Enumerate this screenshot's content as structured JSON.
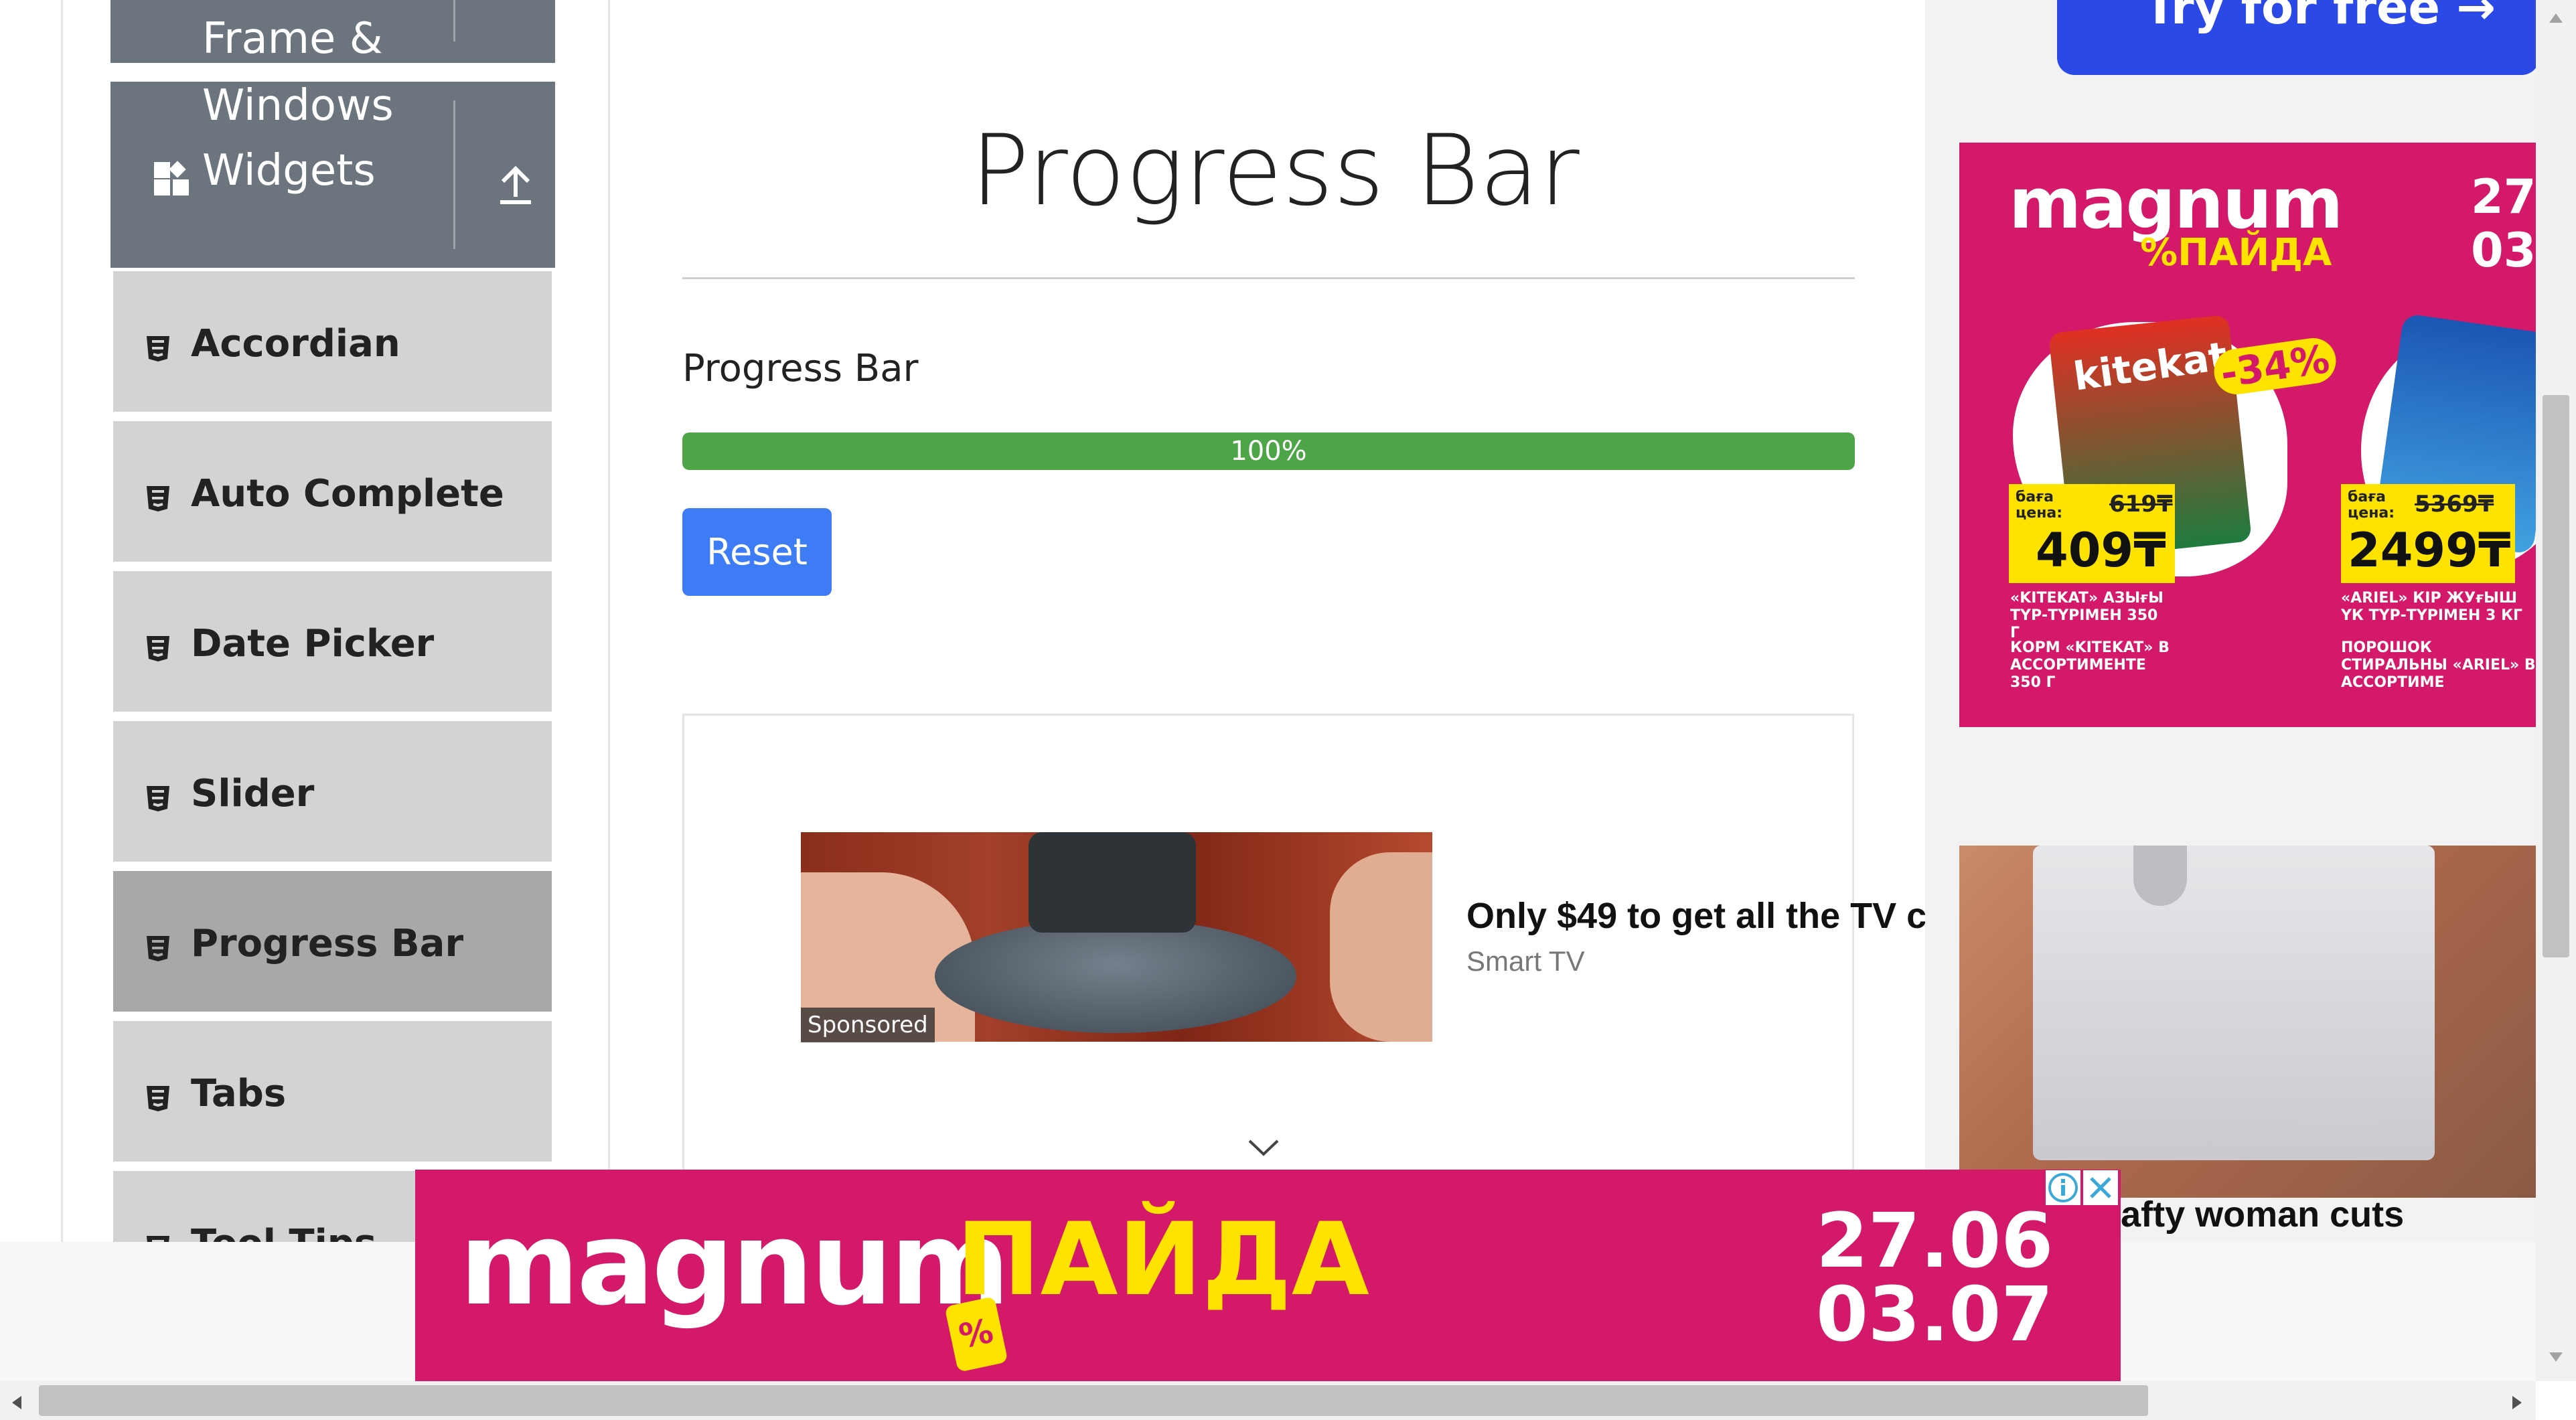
{
  "sidebar": {
    "category_frames": "Frame &\nWindows",
    "category_widgets": "Widgets",
    "items": [
      {
        "label": "Accordian"
      },
      {
        "label": "Auto Complete"
      },
      {
        "label": "Date Picker"
      },
      {
        "label": "Slider"
      },
      {
        "label": "Progress Bar"
      },
      {
        "label": "Tabs"
      },
      {
        "label": "Tool Tips"
      }
    ],
    "active_item": "Progress Bar"
  },
  "main": {
    "title": "Progress Bar",
    "section_label": "Progress Bar",
    "progress": {
      "value": 100,
      "text": "100%"
    },
    "reset_label": "Reset"
  },
  "ad_sponsored": {
    "sponsored_label": "Sponsored",
    "headline": "Only $49 to get all the TV c",
    "source": "Smart TV"
  },
  "right_ads": {
    "try_label": "Try for free →",
    "magnum_logo": "magnum",
    "magnum_sub": "%ПАЙДА",
    "date_start": "27.",
    "date_end": "03.",
    "product1": {
      "brand": "kitekat",
      "discount": "-34%",
      "price_label": "баға цена:",
      "old_price": "619₸",
      "price": "409₸",
      "desc_kz": "«KITEKAT» АЗЫғЫ ТҮР-ТҮРІМЕН 350 Г",
      "desc_ru": "КОРМ «KITEKAT» В АССОРТИМЕНТЕ 350 Г"
    },
    "product2": {
      "price_label": "баға цена:",
      "old_price": "5369₸",
      "price": "2499₸",
      "desc_kz": "«ARIEL» КІР ЖУғЫШ ҮК ТҮР-ТҮРІМЕН 3 КГ",
      "desc_ru": "ПОРОШОК СТИРАЛЬНЫ «ARIEL» В АССОРТИМЕ"
    },
    "caption": "How a crafty woman cuts"
  },
  "bottom_banner": {
    "logo": "magnum",
    "logo_accent": "ПАЙДА",
    "tag": "%",
    "date1": "27.06",
    "date2": "03.07"
  },
  "colors": {
    "sidebar_category": "#6c757d",
    "sidebar_item": "#d3d3d3",
    "sidebar_active": "#a8a8a8",
    "progress": "#4ea548",
    "button": "#3d7cf5",
    "magnum_pink": "#d4186a",
    "magnum_yellow": "#ffe300"
  }
}
